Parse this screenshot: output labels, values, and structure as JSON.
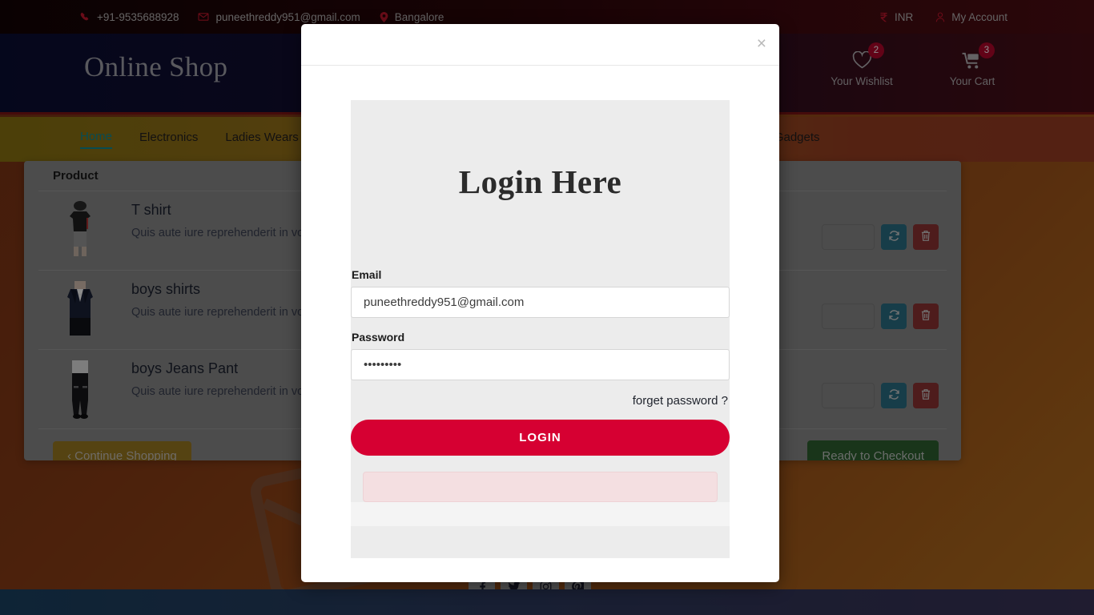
{
  "topbar": {
    "phone": "+91-9535688928",
    "email": "puneethreddy951@gmail.com",
    "location": "Bangalore",
    "currency": "INR",
    "account": "My Account"
  },
  "header": {
    "logo": "Online Shop",
    "wishlist_label": "Your Wishlist",
    "wishlist_count": "2",
    "cart_label": "Your Cart",
    "cart_count": "3"
  },
  "nav": {
    "items": [
      {
        "label": "Home",
        "active": true
      },
      {
        "label": "Electronics",
        "active": false
      },
      {
        "label": "Ladies Wears",
        "active": false
      },
      {
        "label": "Gadgets",
        "active": false
      }
    ]
  },
  "cart": {
    "column_header": "Product",
    "rows": [
      {
        "title": "T shirt",
        "description": "Quis aute iure reprehenderit in voluptate velit esse cillum dolore eu fugiat nulla pariatur. Lorem ipsum dolor",
        "qty": "",
        "image": "tshirt-model"
      },
      {
        "title": "boys shirts",
        "description": "Quis aute iure reprehenderit in voluptate velit esse cillum dolore eu fugiat nulla pariatur. Lorem ipsum dolor",
        "qty": "",
        "image": "blazer-model"
      },
      {
        "title": "boys Jeans Pant",
        "description": "Quis aute iure reprehenderit in voluptate velit esse cillum dolore eu fugiat nulla pariatur. Lorem ipsum dolor",
        "qty": "",
        "image": "jeans-model"
      }
    ],
    "continue_label": "‹ Continue Shopping",
    "checkout_label": "Ready to Checkout"
  },
  "modal": {
    "close_label": "×",
    "title": "Login Here",
    "email_label": "Email",
    "email_value": "puneethreddy951@gmail.com",
    "email_placeholder": "Email",
    "password_label": "Password",
    "password_value": "•••••••••",
    "password_placeholder": "Password",
    "forget_label": "forget password ?",
    "login_label": "LOGIN",
    "alert_text": ""
  },
  "footer": {
    "social": [
      "facebook-icon",
      "twitter-icon",
      "instagram-icon",
      "pinterest-icon"
    ]
  },
  "colors": {
    "accent_red": "#d60032",
    "badge_red": "#b3062b",
    "nav_active": "#108a96",
    "checkout_green": "#2f6130",
    "continue_gold": "#9c7a22",
    "refresh_teal": "#2b7086",
    "delete_red": "#8e3434"
  }
}
